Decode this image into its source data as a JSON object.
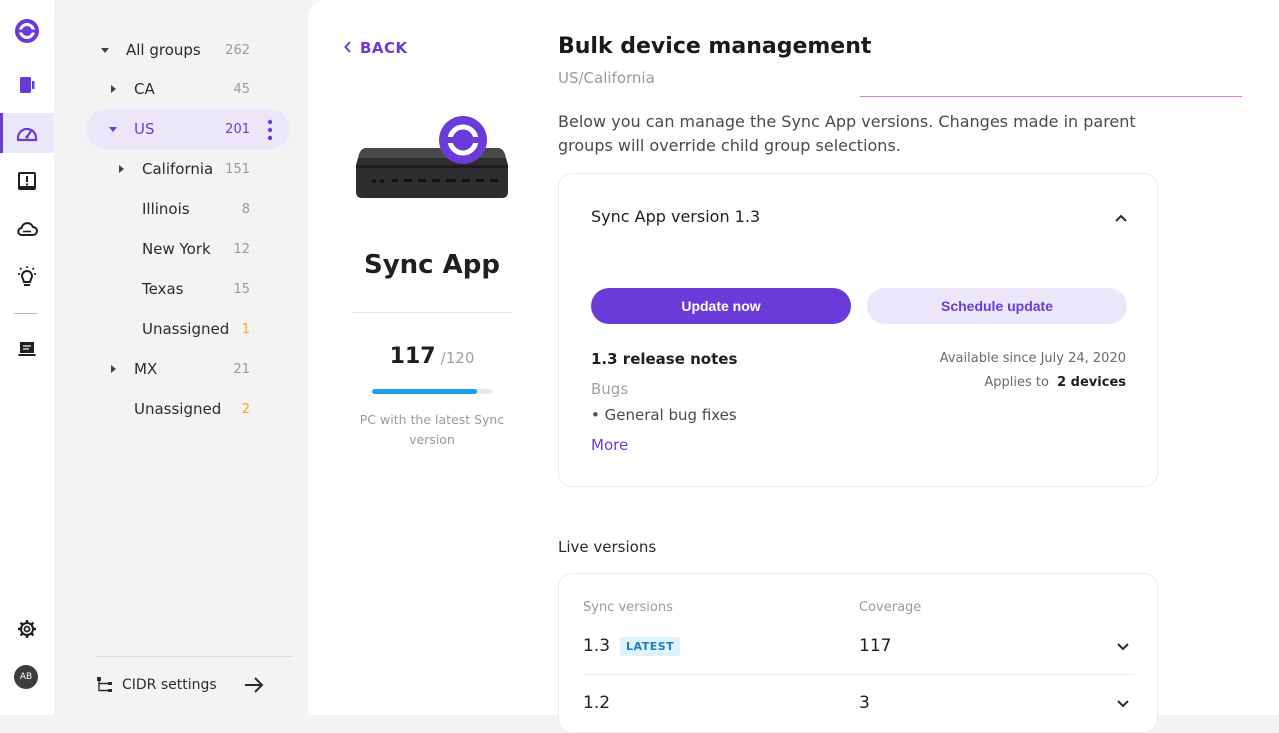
{
  "colors": {
    "accent": "#6b3bd9",
    "progress": "#1aa1e6",
    "warning": "#f5a623"
  },
  "rail": {
    "icons": [
      "logo-icon",
      "devices-icon",
      "dashboard-icon",
      "alerts-icon",
      "cloud-icon",
      "insights-icon",
      "displays-icon",
      "settings-icon"
    ],
    "avatar": "AB"
  },
  "groups": {
    "all": {
      "label": "All groups",
      "count": "262"
    },
    "items": [
      {
        "label": "CA",
        "count": "45"
      },
      {
        "label": "US",
        "count": "201"
      },
      {
        "label": "California",
        "count": "151"
      },
      {
        "label": "Illinois",
        "count": "8"
      },
      {
        "label": "New York",
        "count": "12"
      },
      {
        "label": "Texas",
        "count": "15"
      },
      {
        "label": "Unassigned",
        "count": "1"
      },
      {
        "label": "MX",
        "count": "21"
      },
      {
        "label": "Unassigned",
        "count": "2"
      }
    ],
    "cidr": "CIDR settings"
  },
  "back": "BACK",
  "app": {
    "name": "Sync App",
    "covered": "117",
    "total": "/120",
    "progress": 0.875,
    "caption": "PC with the latest Sync version"
  },
  "header": {
    "title": "Bulk device management",
    "path": "US/California",
    "description": "Below you can manage the Sync App versions. Changes made in parent groups will override child group selections."
  },
  "version_card": {
    "title": "Sync App version 1.3",
    "update_now": "Update now",
    "schedule": "Schedule update",
    "notes_title": "1.3 release notes",
    "available": "Available since July 24, 2020",
    "applies_label": "Applies to",
    "applies_value": "2 devices",
    "bugs_label": "Bugs",
    "bug_item": "• General bug fixes",
    "more": "More"
  },
  "live": {
    "title": "Live versions",
    "col_versions": "Sync versions",
    "col_coverage": "Coverage",
    "rows": [
      {
        "version": "1.3",
        "badge": "LATEST",
        "coverage": "117"
      },
      {
        "version": "1.2",
        "coverage": "3"
      }
    ]
  }
}
